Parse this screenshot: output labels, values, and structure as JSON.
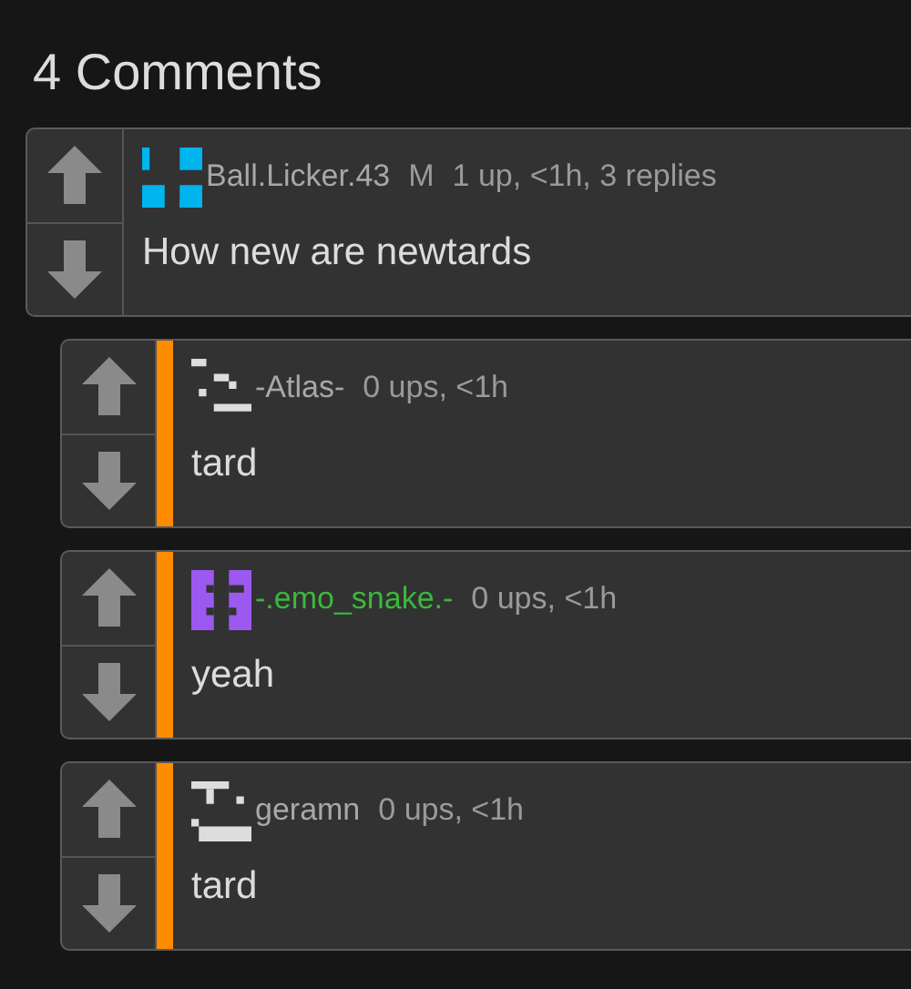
{
  "heading": "4 Comments",
  "comments": [
    {
      "user": {
        "name": "Ball.Licker.43",
        "color": "#a8a8a8"
      },
      "avatar": {
        "color": "#00b4ee"
      },
      "badge": "M",
      "meta": "1 up, <1h, 3 replies",
      "text": "How new are newtards",
      "children": [
        {
          "user": {
            "name": "-Atlas-",
            "color": "#a8a8a8"
          },
          "avatar": {
            "color": "#dddddd"
          },
          "meta": "0 ups, <1h",
          "text": "tard"
        },
        {
          "user": {
            "name": "-.emo_snake.-",
            "color": "#3cb83c"
          },
          "avatar": {
            "color": "#9b59f0"
          },
          "meta": "0 ups, <1h",
          "text": "yeah"
        },
        {
          "user": {
            "name": "geramn",
            "color": "#a8a8a8"
          },
          "avatar": {
            "color": "#dddddd"
          },
          "meta": "0 ups, <1h",
          "text": "tard"
        }
      ]
    }
  ]
}
